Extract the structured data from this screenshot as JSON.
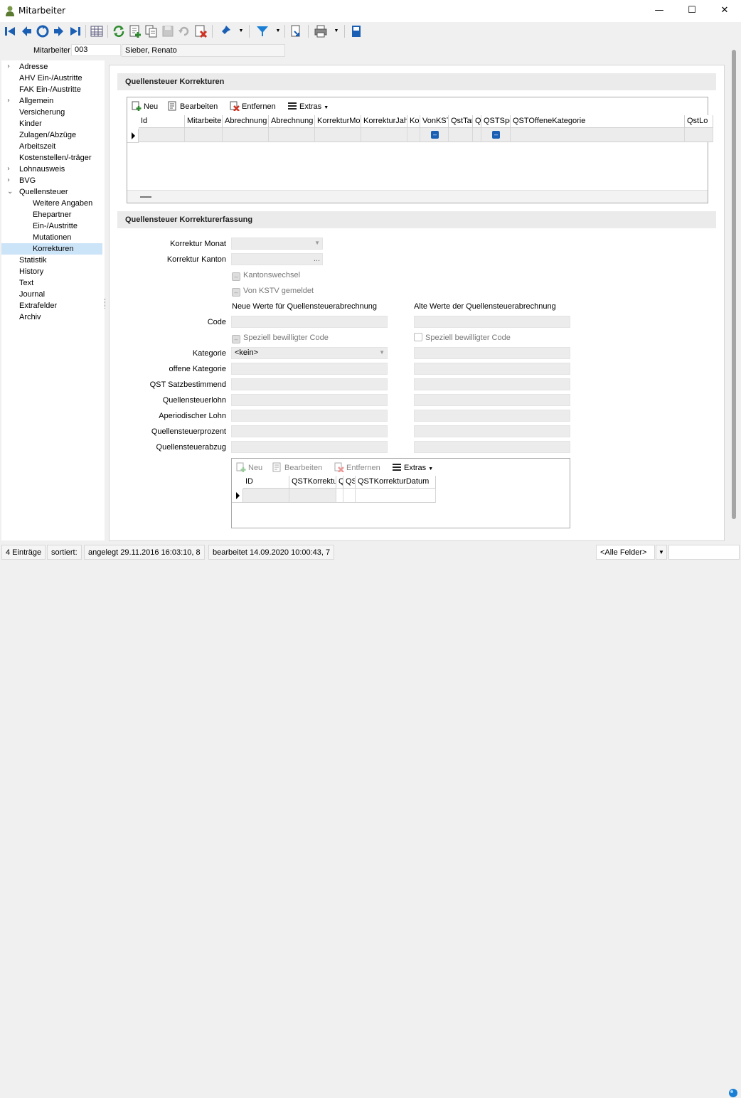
{
  "window": {
    "title": "Mitarbeiter",
    "minimize": "—",
    "maximize": "☐",
    "close": "✕"
  },
  "header": {
    "label": "Mitarbeiter",
    "employee_id": "003",
    "employee_name": "Sieber, Renato"
  },
  "nav": {
    "items": [
      {
        "label": "Adresse",
        "chevron": "›"
      },
      {
        "label": "AHV Ein-/Austritte"
      },
      {
        "label": "FAK Ein-/Austritte"
      },
      {
        "label": "Allgemein",
        "chevron": "›"
      },
      {
        "label": "Versicherung"
      },
      {
        "label": "Kinder"
      },
      {
        "label": "Zulagen/Abzüge"
      },
      {
        "label": "Arbeitszeit"
      },
      {
        "label": "Kostenstellen/-träger"
      },
      {
        "label": "Lohnausweis",
        "chevron": "›"
      },
      {
        "label": "BVG",
        "chevron": "›"
      },
      {
        "label": "Quellensteuer",
        "chevron": "⌄"
      },
      {
        "label": "Weitere Angaben"
      },
      {
        "label": "Ehepartner"
      },
      {
        "label": "Ein-/Austritte"
      },
      {
        "label": "Mutationen"
      },
      {
        "label": "Korrekturen"
      },
      {
        "label": "Statistik"
      },
      {
        "label": "History"
      },
      {
        "label": "Text"
      },
      {
        "label": "Journal"
      },
      {
        "label": "Extrafelder"
      },
      {
        "label": "Archiv"
      }
    ]
  },
  "section1": {
    "title": "Quellensteuer Korrekturen",
    "toolbar": {
      "new": "Neu",
      "edit": "Bearbeiten",
      "remove": "Entfernen",
      "extras": "Extras"
    },
    "columns": [
      "Id",
      "Mitarbeite",
      "Abrechnung",
      "Abrechnung",
      "KorrekturMo",
      "KorrekturJah",
      "Ko",
      "VonKST",
      "QstTar",
      "Q",
      "QSTSpe",
      "QSTOffeneKategorie",
      "QstLo"
    ],
    "checkbox_mark": "–"
  },
  "section2": {
    "title": "Quellensteuer Korrekturerfassung",
    "labels": {
      "monat": "Korrektur Monat",
      "kanton": "Korrektur Kanton",
      "kantonswechsel": "Kantonswechsel",
      "kstv": "Von KSTV gemeldet",
      "neue": "Neue Werte für Quellensteuerabrechnung",
      "alte": "Alte Werte der Quellensteuerabrechnung",
      "code": "Code",
      "spez": "Speziell bewilligter Code",
      "kategorie": "Kategorie",
      "offene": "offene Kategorie",
      "satz": "QST Satzbestimmend",
      "lohn": "Quellensteuerlohn",
      "aperiod": "Aperiodischer Lohn",
      "prozent": "Quellensteuerprozent",
      "abzug": "Quellensteuerabzug"
    },
    "kategorie_value": "<kein>",
    "kanton_button": "...",
    "check_mark": "–",
    "toolbar": {
      "new": "Neu",
      "edit": "Bearbeiten",
      "remove": "Entfernen",
      "extras": "Extras"
    },
    "columns": [
      "ID",
      "QSTKorrektu",
      "Q",
      "QS",
      "QSTKorrekturDatum"
    ]
  },
  "status": {
    "count": "4 Einträge",
    "sorted": "sortiert:",
    "created": "angelegt 29.11.2016 16:03:10,  8",
    "edited": "bearbeitet 14.09.2020 10:00:43,  7",
    "filter": "<Alle Felder>"
  },
  "colors": {
    "accent": "#1a5fb4",
    "nav_selected": "#cce4f7",
    "section_bg": "#ebebeb"
  }
}
